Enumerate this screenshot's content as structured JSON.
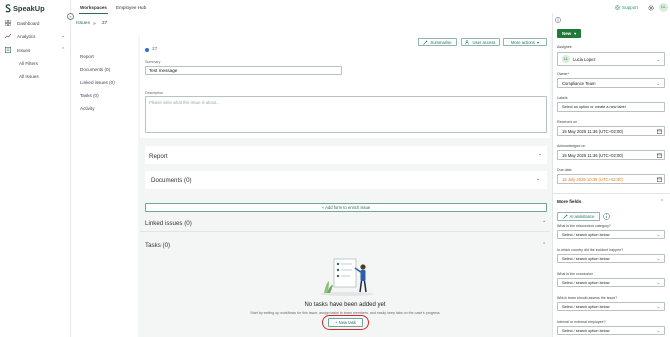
{
  "brand": {
    "name": "SpeakUp"
  },
  "sidebar": {
    "items": [
      {
        "label": "Dashboard"
      },
      {
        "label": "Analytics"
      },
      {
        "label": "Issues"
      }
    ],
    "sub_items": [
      {
        "label": "All Filters"
      },
      {
        "label": "All Issues"
      }
    ],
    "collapse_glyph": "«"
  },
  "topbar": {
    "tabs": [
      {
        "label": "Workspaces"
      },
      {
        "label": "Employee Hub"
      }
    ],
    "support_label": "Support",
    "avatar_initials": "LL"
  },
  "breadcrumb": {
    "root": "Issues",
    "separator": "»",
    "current": "27"
  },
  "sections_nav": [
    {
      "label": "Report"
    },
    {
      "label": "Documents (0)"
    },
    {
      "label": "Linked issues (0)"
    },
    {
      "label": "Tasks (0)"
    },
    {
      "label": "Activity"
    }
  ],
  "issue": {
    "number": "27",
    "summary_label": "Summary",
    "summary_value": "Test message",
    "description_label": "Description",
    "description_placeholder": "Please write what this issue is about...",
    "actions": {
      "summarise": "Summarise",
      "user_access": "User access",
      "more_actions": "More actions"
    }
  },
  "panels": {
    "report": "Report",
    "documents": "Documents (0)",
    "add_form": "+ Add form to enrich issue",
    "linked_issues": "Linked issues (0)",
    "tasks": "Tasks (0)"
  },
  "tasks_empty": {
    "title": "No tasks have been added yet",
    "subtitle": "Start by setting up workflows for this issue, assign tasks to team members, and easily keep tabs on the case's progress",
    "new_task_label": "+ New task"
  },
  "details": {
    "new_button": "New",
    "assignee_label": "Assignee",
    "assignee_initials": "LL",
    "assignee_name": "Lucia Lopez",
    "owner_label": "Owner*",
    "owner_value": "Compliance Team",
    "labels_label": "Labels",
    "labels_placeholder": "Select an option or create a new label",
    "received_label": "Received on",
    "received_value": "15 May 2025 11:36 (UTC+02:00)",
    "acknowledged_label": "Acknowledged on",
    "acknowledged_value": "15 May 2025 11:36 (UTC+02:00)",
    "due_label": "Due date",
    "due_value": "15 July 2025 10:35 (UTC+02:00)",
    "more_fields": "More fields",
    "ai_assistance": "AI assistance",
    "questions": [
      "What is the misconduct category?",
      "In which country did the incident happen?",
      "What is the conclusion",
      "Which team should assess the issue?",
      "Internal or external employee?"
    ],
    "select_placeholder": "Select / search option below"
  },
  "colors": {
    "accent": "#2d6b62",
    "new_button": "#1f7a3a",
    "due_date": "#e07a1f",
    "highlight_ring": "#d62828",
    "support": "#2a9d59"
  }
}
